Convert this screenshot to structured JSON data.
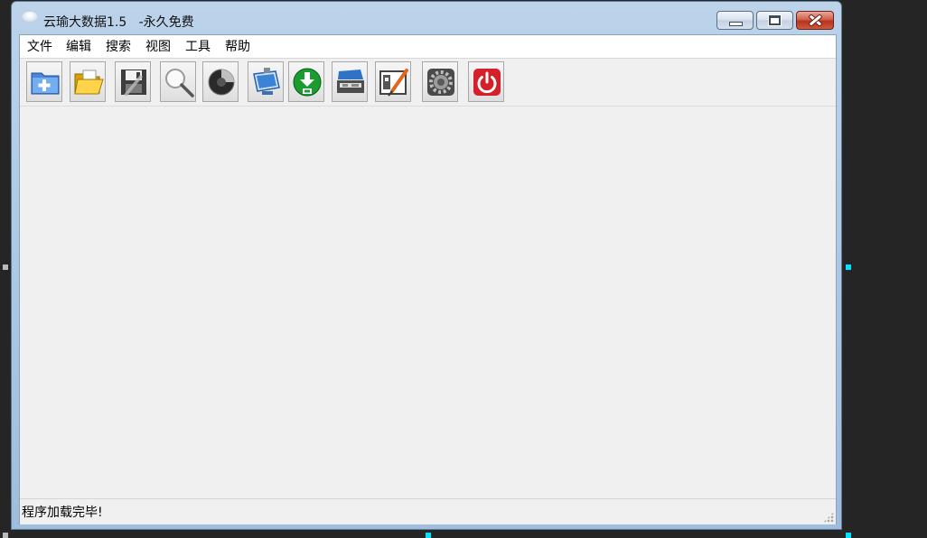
{
  "window": {
    "title": "云瑜大数据1.5   -永久免费"
  },
  "menubar": {
    "items": [
      {
        "label": "文件"
      },
      {
        "label": "编辑"
      },
      {
        "label": "搜索"
      },
      {
        "label": "视图"
      },
      {
        "label": "工具"
      },
      {
        "label": "帮助"
      }
    ]
  },
  "toolbar": {
    "buttons": [
      {
        "icon": "new-folder-icon"
      },
      {
        "icon": "open-folder-icon"
      },
      {
        "icon": "save-disk-icon"
      },
      {
        "icon": "magnifier-icon"
      },
      {
        "icon": "dark-disc-icon"
      },
      {
        "icon": "monitor-icon"
      },
      {
        "icon": "download-icon"
      },
      {
        "icon": "toolbox-icon"
      },
      {
        "icon": "tools-icon"
      },
      {
        "icon": "gear-icon"
      },
      {
        "icon": "power-icon"
      }
    ]
  },
  "statusbar": {
    "text": "程序加载完毕!"
  },
  "colors": {
    "desktop": "#252525",
    "title_bar": "#b3cbe6",
    "client": "#f0f0f0",
    "close_button": "#c94a31",
    "selection_handle": "#00e5ff"
  }
}
